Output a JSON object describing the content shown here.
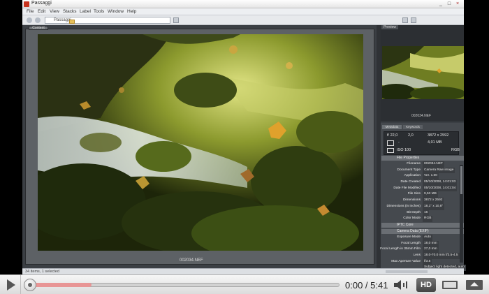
{
  "window": {
    "title": "Passaggi",
    "controls": [
      "_",
      "□",
      "×"
    ]
  },
  "menu": [
    "File",
    "Edit",
    "View",
    "Stacks",
    "Label",
    "Tools",
    "Window",
    "Help"
  ],
  "toolbar": {
    "path": "Passaggi"
  },
  "content": {
    "tab_label": "Content",
    "filename": "002034.NEF"
  },
  "preview": {
    "tab_label": "Preview",
    "filename": "002034.NEF"
  },
  "metadata": {
    "tabs": [
      "Metadata",
      "Keywords"
    ],
    "exif": {
      "aperture": "f/ 22,0",
      "shutter": "2,0",
      "dims": "3872 x 2592",
      "size": "4,01 MB",
      "ev": "-",
      "iso": "ISO 100",
      "mode": "RGB"
    },
    "section_file": "File Properties",
    "properties": [
      {
        "label": "Filename",
        "value": "002034.NEF"
      },
      {
        "label": "Document Type",
        "value": "Camera Raw image"
      },
      {
        "label": "Application",
        "value": "Ver. 1.00"
      },
      {
        "label": "Date Created",
        "value": "05/10/2008, 14:01:03"
      },
      {
        "label": "Date File Modified",
        "value": "05/10/2008, 14:01:04"
      },
      {
        "label": "File Size",
        "value": "9,53 MB"
      },
      {
        "label": "Dimensions",
        "value": "3872 x 2592"
      },
      {
        "label": "Dimensions (in inches)",
        "value": "18,1\" x 10,8\""
      },
      {
        "label": "Bit Depth",
        "value": "16"
      },
      {
        "label": "Color Mode",
        "value": "RGB"
      }
    ],
    "section_iptc": "IPTC Core",
    "section_camera": "Camera Data (EXIF)",
    "camera": [
      {
        "label": "Exposure Mode",
        "value": "Auto"
      },
      {
        "label": "Focal Length",
        "value": "18,0 mm"
      },
      {
        "label": "Focal Length in 35mm Film",
        "value": "27,0 mm"
      },
      {
        "label": "Lens",
        "value": "18.0-70.0 mm f/3.5-4.5"
      },
      {
        "label": "Max Aperture Value",
        "value": "f/3.5"
      },
      {
        "label": "",
        "value": "Subject light detected, auto"
      }
    ]
  },
  "status": "34 items, 1 selected",
  "player": {
    "time": "0:00 / 5:41",
    "progress_fraction": 0.0,
    "buffered_fraction": 0.2,
    "hd_label": "HD"
  }
}
